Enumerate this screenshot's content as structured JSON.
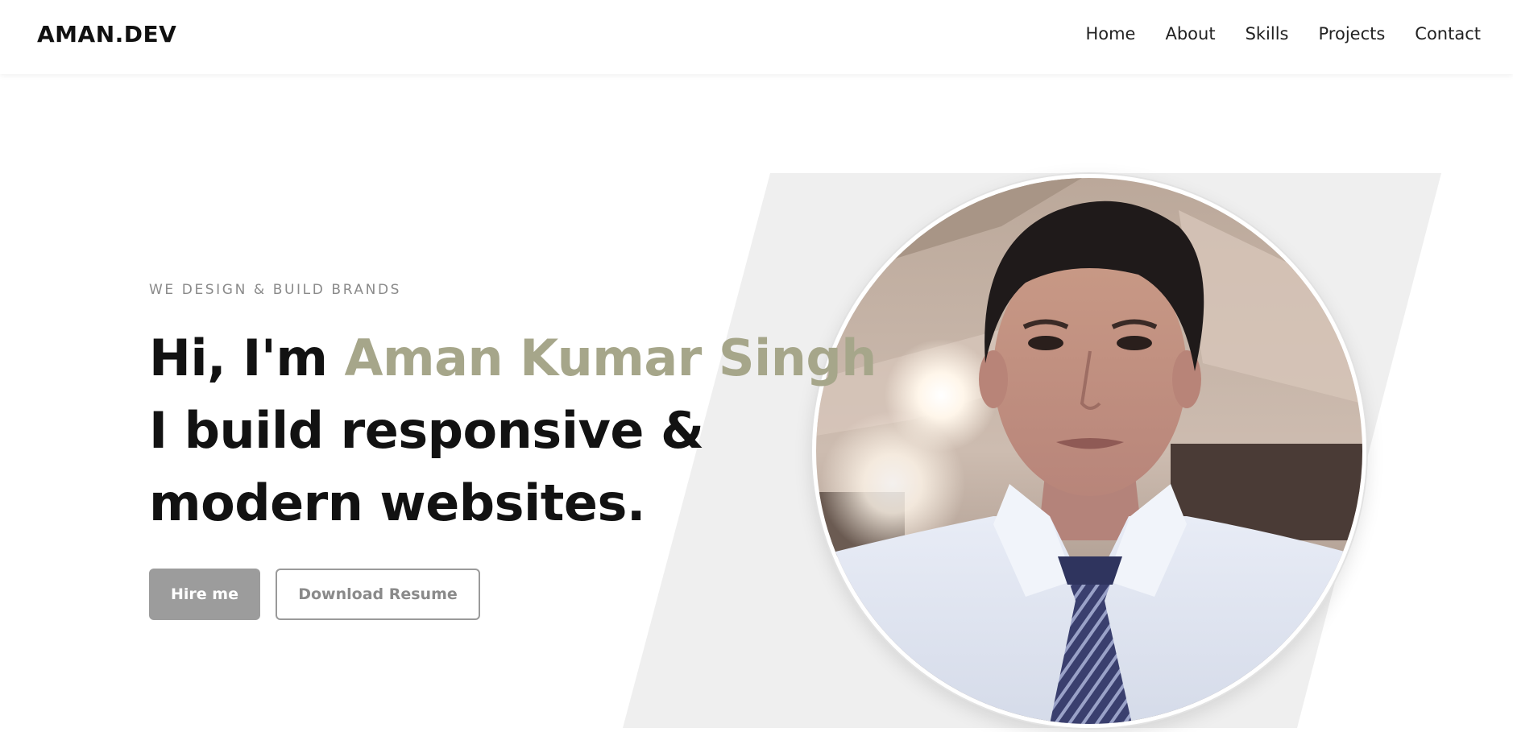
{
  "header": {
    "logo": "AMAN.DEV",
    "nav": [
      "Home",
      "About",
      "Skills",
      "Projects",
      "Contact"
    ]
  },
  "hero": {
    "tagline": "WE DESIGN & BUILD BRANDS",
    "greeting": "Hi, I'm",
    "name": "Aman Kumar Singh",
    "line2": "I build responsive &",
    "line3": "modern websites.",
    "buttons": {
      "primary": "Hire me",
      "secondary": "Download Resume"
    }
  },
  "colors": {
    "accent": "#a6a68a",
    "backdrop": "#efefef",
    "primary_button": "#9c9c9c",
    "text": "#121212"
  }
}
